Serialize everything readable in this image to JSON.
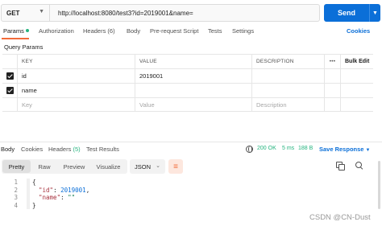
{
  "request": {
    "method": "GET",
    "url": "http://localhost:8080/test3?id=2019001&name=",
    "send_label": "Send"
  },
  "request_tabs": [
    {
      "label": "Params",
      "active": true
    },
    {
      "label": "Authorization"
    },
    {
      "label": "Headers (6)"
    },
    {
      "label": "Body"
    },
    {
      "label": "Pre-request Script"
    },
    {
      "label": "Tests"
    },
    {
      "label": "Settings"
    }
  ],
  "cookies_label": "Cookies",
  "query_params": {
    "title": "Query Params",
    "columns": [
      "KEY",
      "VALUE",
      "DESCRIPTION"
    ],
    "more_icon": "ellipsis-icon",
    "bulk_edit_label": "Bulk Edit",
    "rows": [
      {
        "checked": true,
        "key": "id",
        "value": "2019001",
        "description": ""
      },
      {
        "checked": true,
        "key": "name",
        "value": "",
        "description": ""
      }
    ],
    "placeholder": {
      "key": "Key",
      "value": "Value",
      "description": "Description"
    }
  },
  "response_tabs": [
    {
      "label": "Body",
      "active": true
    },
    {
      "label": "Cookies"
    },
    {
      "label": "Headers",
      "count": "(5)"
    },
    {
      "label": "Test Results"
    }
  ],
  "response_status": {
    "status": "200 OK",
    "time": "5 ms",
    "size": "188 B",
    "save_label": "Save Response"
  },
  "format_tabs": [
    {
      "label": "Pretty",
      "active": true
    },
    {
      "label": "Raw"
    },
    {
      "label": "Preview"
    },
    {
      "label": "Visualize"
    }
  ],
  "format_select": "JSON",
  "code_lines": [
    {
      "n": "1",
      "text": "{"
    },
    {
      "n": "2",
      "key": "\"id\"",
      "sep": ": ",
      "val": "2019001",
      "tail": ",",
      "kind": "num"
    },
    {
      "n": "3",
      "key": "\"name\"",
      "sep": ": ",
      "val": "\"\"",
      "tail": "",
      "kind": "str"
    },
    {
      "n": "4",
      "text": "}"
    }
  ],
  "watermark": "CSDN @CN-Dust",
  "colors": {
    "accent": "#0b6fd8",
    "active_tab": "#f26b3a",
    "success": "#26b47f"
  }
}
